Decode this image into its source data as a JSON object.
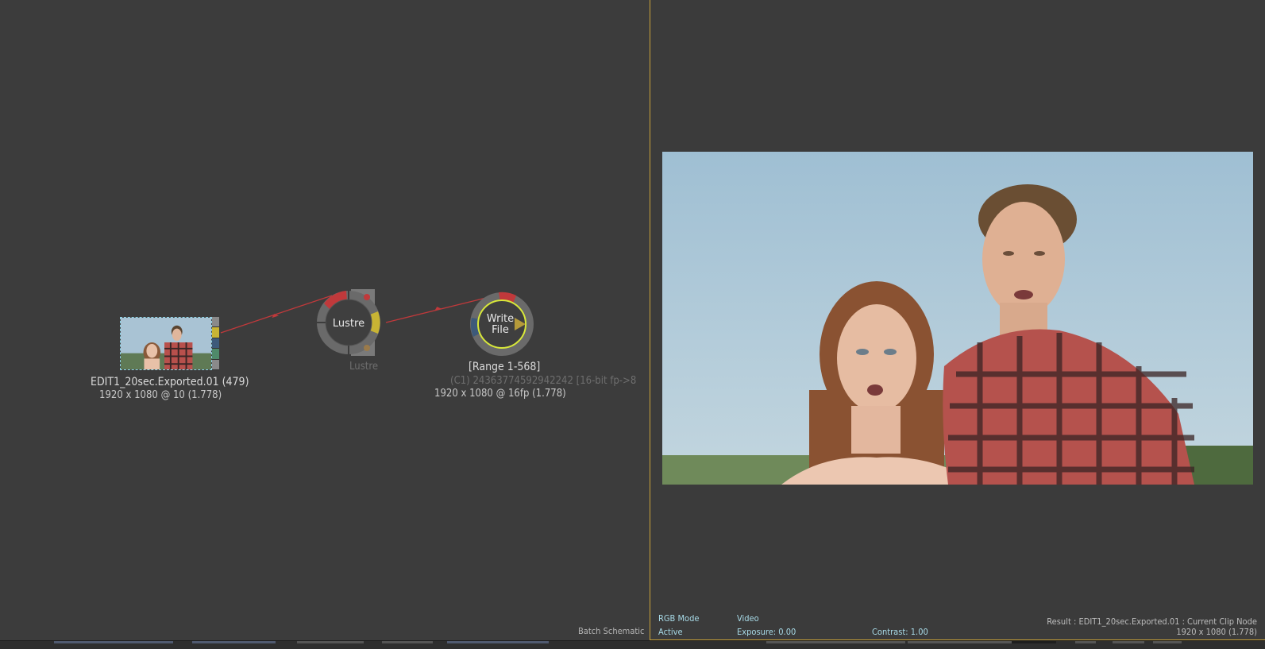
{
  "schematic": {
    "panel_label": "Batch Schematic",
    "clip_node": {
      "name": "EDIT1_20sec.Exported.01 (479)",
      "resolution": "1920 x 1080 @ 10 (1.778)"
    },
    "lustre_node": {
      "inner_label": "Lustre",
      "caption": "Lustre"
    },
    "write_node": {
      "inner_label_line1": "Write",
      "inner_label_line2": "File",
      "range": "[Range  1-568]",
      "detail": "(C1) 24363774592942242 [16-bit fp->8",
      "resolution": "1920 x 1080 @ 16fp (1.778)"
    }
  },
  "viewer": {
    "rgb_mode": "RGB Mode",
    "active": "Active",
    "video": "Video",
    "exposure": "Exposure: 0.00",
    "contrast": "Contrast: 1.00",
    "result": "Result : EDIT1_20sec.Exported.01 : Current Clip Node",
    "result_resolution": "1920 x 1080 (1.778)"
  },
  "colors": {
    "background": "#3b3b3b",
    "divider_accent": "#c9a23a",
    "link": "#c0393b",
    "viewer_text": "#a8dbe8",
    "write_ring": "#d8e83a"
  }
}
